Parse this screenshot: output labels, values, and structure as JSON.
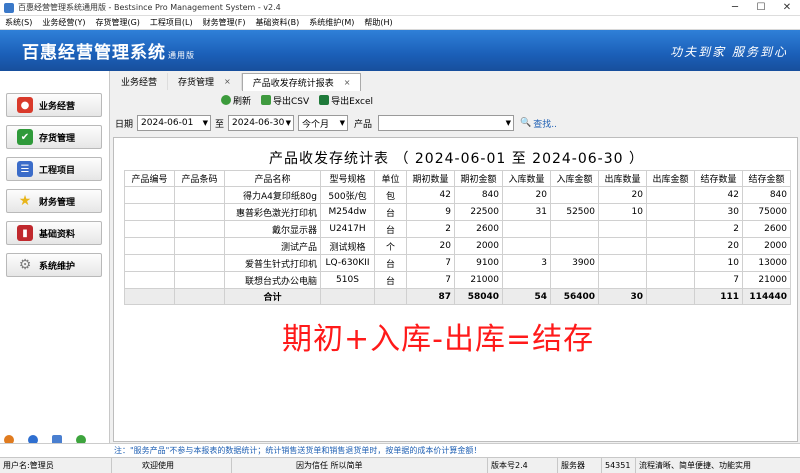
{
  "window": {
    "title": "百惠经营管理系统通用版 - Bestsince Pro Management System - v2.4"
  },
  "menu": [
    "系统(S)",
    "业务经营(Y)",
    "存货管理(G)",
    "工程项目(L)",
    "财务管理(F)",
    "基础资料(B)",
    "系统维护(M)",
    "帮助(H)"
  ],
  "banner": {
    "name": "百惠经营管理系统",
    "edition": "通用版",
    "slogan": "功夫到家 服务到心"
  },
  "sidebar": [
    {
      "label": "业务经营",
      "icon": "business-icon",
      "color": "#d93a2b"
    },
    {
      "label": "存货管理",
      "icon": "check-icon",
      "color": "#2f9a3a"
    },
    {
      "label": "工程项目",
      "icon": "list-icon",
      "color": "#3b6cc9"
    },
    {
      "label": "财务管理",
      "icon": "star-icon",
      "color": "#e8b51a"
    },
    {
      "label": "基础资料",
      "icon": "book-icon",
      "color": "#c0282d"
    },
    {
      "label": "系统维护",
      "icon": "gear-icon",
      "color": "#7b7b7b"
    }
  ],
  "tabs": [
    {
      "label": "业务经营",
      "closable": false
    },
    {
      "label": "存货管理",
      "closable": true
    },
    {
      "label": "产品收发存统计报表",
      "closable": true
    }
  ],
  "toolbar": {
    "refresh": "刷新",
    "export_csv": "导出CSV",
    "export_excel": "导出Excel"
  },
  "filter": {
    "date_label": "日期",
    "start": "2024-06-01",
    "to": "至",
    "end": "2024-06-30",
    "period": "今个月",
    "product_label": "产品",
    "product_value": "",
    "search": "查找.."
  },
  "report": {
    "title": "产品收发存统计表 （ 2024-06-01  至  2024-06-30 ）",
    "columns": [
      "产品编号",
      "产品条码",
      "产品名称",
      "型号规格",
      "单位",
      "期初数量",
      "期初金额",
      "入库数量",
      "入库金额",
      "出库数量",
      "出库金额",
      "结存数量",
      "结存金额"
    ],
    "rows": [
      [
        "",
        "",
        "得力A4复印纸80g",
        "500张/包",
        "包",
        "42",
        "840",
        "20",
        "",
        "20",
        "",
        "42",
        "840"
      ],
      [
        "",
        "",
        "惠普彩色激光打印机",
        "M254dw",
        "台",
        "9",
        "22500",
        "31",
        "52500",
        "10",
        "",
        "30",
        "75000"
      ],
      [
        "",
        "",
        "戴尔显示器",
        "U2417H",
        "台",
        "2",
        "2600",
        "",
        "",
        "",
        "",
        "2",
        "2600"
      ],
      [
        "",
        "",
        "测试产品",
        "测试规格",
        "个",
        "20",
        "2000",
        "",
        "",
        "",
        "",
        "20",
        "2000"
      ],
      [
        "",
        "",
        "爱普生针式打印机",
        "LQ-630KII",
        "台",
        "7",
        "9100",
        "3",
        "3900",
        "",
        "",
        "10",
        "13000"
      ],
      [
        "",
        "",
        "联想台式办公电脑",
        "510S",
        "台",
        "7",
        "21000",
        "",
        "",
        "",
        "",
        "7",
        "21000"
      ]
    ],
    "total": [
      "",
      "",
      "合计",
      "",
      "",
      "87",
      "58040",
      "54",
      "56400",
      "30",
      "",
      "111",
      "114440"
    ]
  },
  "overlay_text": "期初+入库-出库=结存",
  "note": "注：\"服务产品\"不参与本报表的数据统计；统计销售送货单和销售退货单时，按单据的成本价计算金额！",
  "status": [
    "用户名:管理员",
    "欢迎使用",
    "因为信任 所以简单",
    "版本号2.4",
    "服务器",
    "54351",
    "流程清晰、简单便捷、功能实用"
  ]
}
